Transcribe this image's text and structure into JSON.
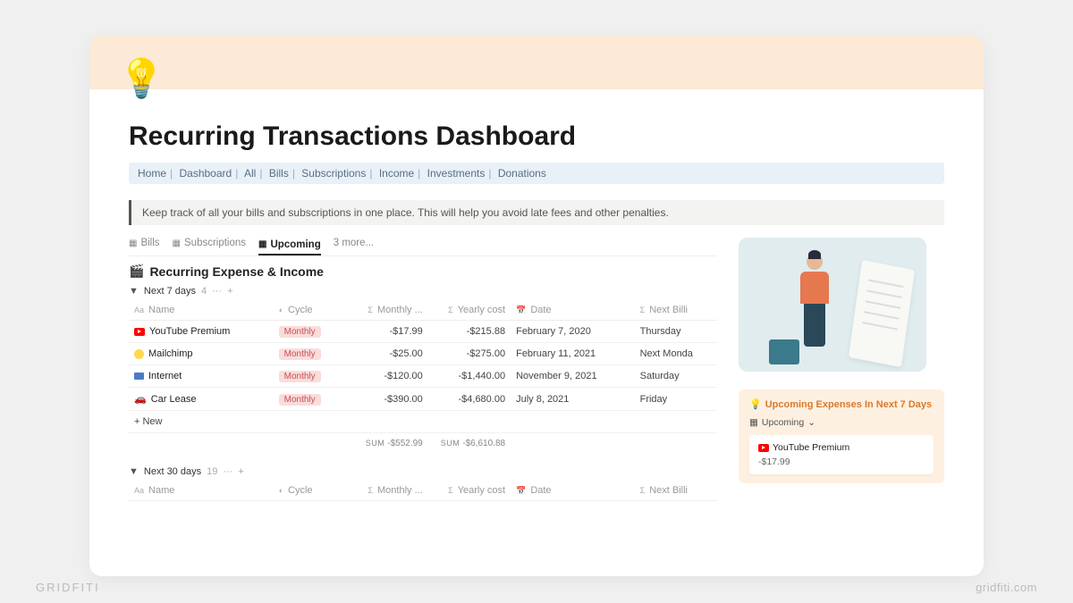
{
  "page": {
    "title": "Recurring Transactions Dashboard",
    "icon": "💡"
  },
  "breadcrumb": [
    "Home",
    "Dashboard",
    "All",
    "Bills",
    "Subscriptions",
    "Income",
    "Investments",
    "Donations"
  ],
  "callout": "Keep track of all your bills and subscriptions in one place. This will help you avoid late fees and other penalties.",
  "tabs": {
    "bills": "Bills",
    "subscriptions": "Subscriptions",
    "upcoming": "Upcoming",
    "more": "3 more..."
  },
  "section": {
    "title": "Recurring Expense & Income",
    "icon": "🎬"
  },
  "group7": {
    "label": "Next 7 days",
    "count": "4"
  },
  "columns": {
    "name": "Name",
    "cycle": "Cycle",
    "monthly": "Monthly ...",
    "yearly": "Yearly cost",
    "date": "Date",
    "next": "Next Billi"
  },
  "rows": [
    {
      "icon": "youtube",
      "name": "YouTube Premium",
      "cycle": "Monthly",
      "monthly": "-$17.99",
      "yearly": "-$215.88",
      "date": "February 7, 2020",
      "next": "Thursday"
    },
    {
      "icon": "mailchimp",
      "name": "Mailchimp",
      "cycle": "Monthly",
      "monthly": "-$25.00",
      "yearly": "-$275.00",
      "date": "February 11, 2021",
      "next": "Next Monda"
    },
    {
      "icon": "internet",
      "name": "Internet",
      "cycle": "Monthly",
      "monthly": "-$120.00",
      "yearly": "-$1,440.00",
      "date": "November 9, 2021",
      "next": "Saturday"
    },
    {
      "icon": "car",
      "name": "Car Lease",
      "cycle": "Monthly",
      "monthly": "-$390.00",
      "yearly": "-$4,680.00",
      "date": "July 8, 2021",
      "next": "Friday"
    }
  ],
  "newRow": "New",
  "sums": {
    "label": "SUM",
    "monthly": "-$552.99",
    "yearly": "-$6,610.88"
  },
  "group30": {
    "label": "Next 30 days",
    "count": "19"
  },
  "sidebar": {
    "title": "Upcoming Expenses In Next 7 Days",
    "viewLabel": "Upcoming",
    "item": {
      "name": "YouTube Premium",
      "price": "-$17.99"
    }
  },
  "footer": {
    "left": "GRIDFITI",
    "right": "gridfiti.com"
  }
}
